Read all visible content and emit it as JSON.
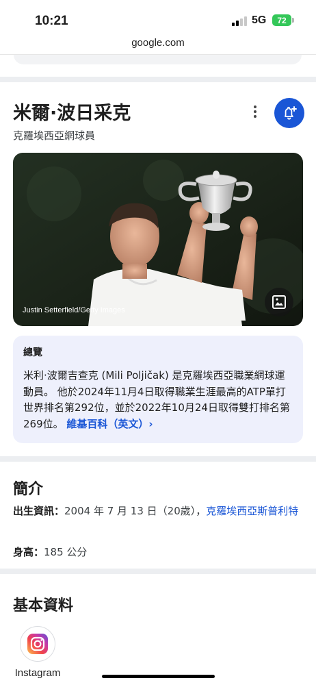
{
  "status_bar": {
    "time": "10:21",
    "network": "5G",
    "battery": "72"
  },
  "browser": {
    "url": "google.com"
  },
  "knowledge_panel": {
    "title": "米爾·波日采克",
    "subtitle": "克羅埃西亞網球員",
    "more_icon": "more-vert-icon",
    "follow_icon": "bell-plus-icon",
    "image_credit": "Justin Setterfield/Getty Images",
    "image_icon": "image-icon",
    "overview": {
      "title": "總覽",
      "text": "米利·波爾吉查克 (Mili Poljičak) 是克羅埃西亞職業網球運動員。 他於2024年11月4日取得職業生涯最高的ATP單打世界排名第292位，並於2022年10月24日取得雙打排名第269位。",
      "link": "維基百科（英文）›"
    }
  },
  "intro": {
    "title": "簡介",
    "birth_label": "出生資訊：",
    "birth_value": "2004 年 7 月 13 日（20歲），",
    "birth_place": "克羅埃西亞斯普利特",
    "height_label": "身高：",
    "height_value": "185 公分"
  },
  "basics": {
    "title": "基本資料",
    "profiles": [
      {
        "label": "Instagram",
        "icon": "instagram-icon"
      }
    ]
  },
  "colors": {
    "accent_blue": "#1a56d6",
    "overview_bg": "#eef0fc",
    "battery_green": "#34c759"
  }
}
